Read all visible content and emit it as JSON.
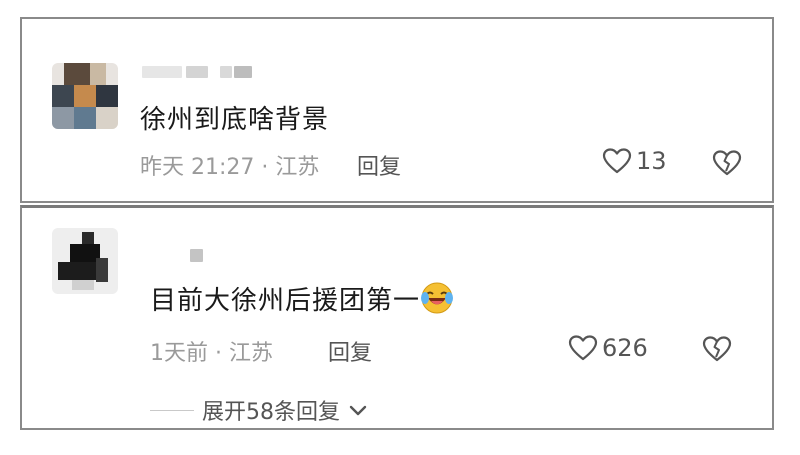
{
  "comments": [
    {
      "username": "",
      "text": "徐州到底啥背景",
      "time_location": "昨天 21:27 · 江苏",
      "reply_label": "回复",
      "likes": "13",
      "like_icon": "heart-outline-icon",
      "dislike_icon": "broken-heart-icon"
    },
    {
      "username": "",
      "text": "目前大徐州后援团第一",
      "emoji": "laughing-crying-emoji",
      "time_location": "1天前 · 江苏",
      "reply_label": "回复",
      "likes": "626",
      "like_icon": "heart-outline-icon",
      "dislike_icon": "broken-heart-icon",
      "expand_label": "展开58条回复",
      "expand_icon": "chevron-down-icon"
    }
  ],
  "colors": {
    "text_primary": "#1a1a1a",
    "text_meta": "#9a9a9a",
    "text_action": "#555555",
    "border": "#8a8a8a"
  }
}
